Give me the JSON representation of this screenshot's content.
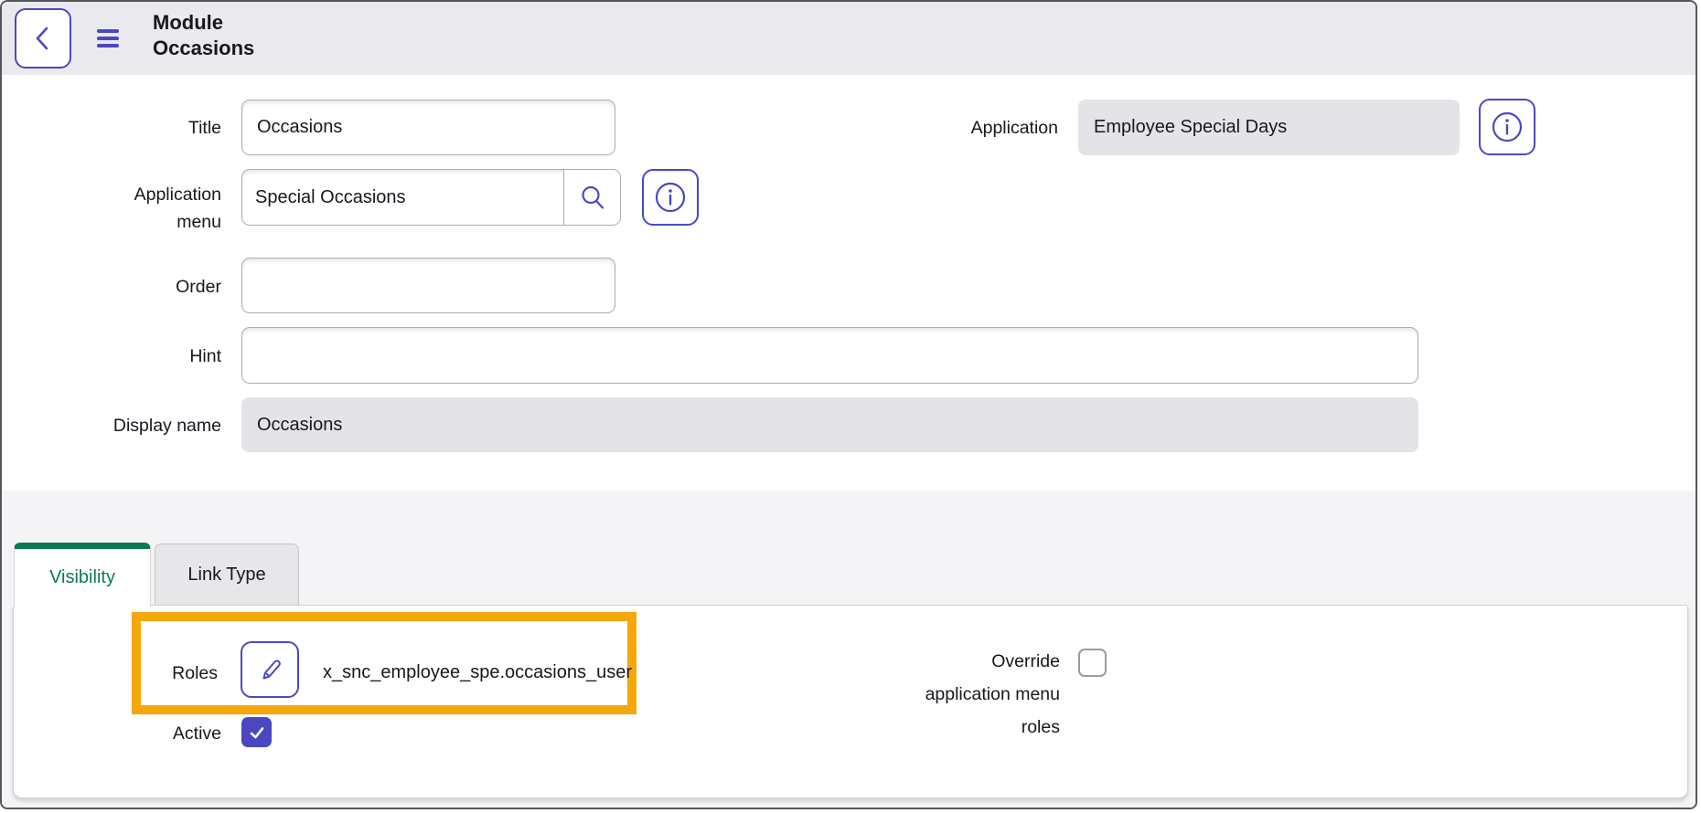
{
  "header": {
    "title_line1": "Module",
    "title_line2": "Occasions"
  },
  "form": {
    "title": {
      "label": "Title",
      "value": "Occasions"
    },
    "application": {
      "label": "Application",
      "value": "Employee Special Days"
    },
    "application_menu": {
      "label": "Application menu",
      "value": "Special Occasions"
    },
    "order": {
      "label": "Order",
      "value": ""
    },
    "hint": {
      "label": "Hint",
      "value": ""
    },
    "display_name": {
      "label": "Display name",
      "value": "Occasions"
    }
  },
  "tabs": {
    "visibility": {
      "label": "Visibility",
      "active": true
    },
    "link_type": {
      "label": "Link Type",
      "active": false
    }
  },
  "visibility_panel": {
    "roles": {
      "label": "Roles",
      "value": "x_snc_employee_spe.occasions_user"
    },
    "active": {
      "label": "Active",
      "checked": true
    },
    "override": {
      "label": "Override application menu roles",
      "checked": false
    }
  },
  "icons": {
    "back": "chevron-left-icon",
    "menu": "hamburger-icon",
    "info": "info-icon",
    "search": "search-icon",
    "edit": "pencil-icon",
    "check": "checkmark-icon"
  },
  "colors": {
    "accent_indigo": "#4b48c4",
    "tab_active_green": "#0b7b51",
    "highlight_orange": "#f5a70a",
    "checkbox_checked": "#4b48bf",
    "readonly_field_bg": "#e3e3e8",
    "header_bg": "#e9e9ee",
    "section_bg": "#f4f4f6"
  }
}
